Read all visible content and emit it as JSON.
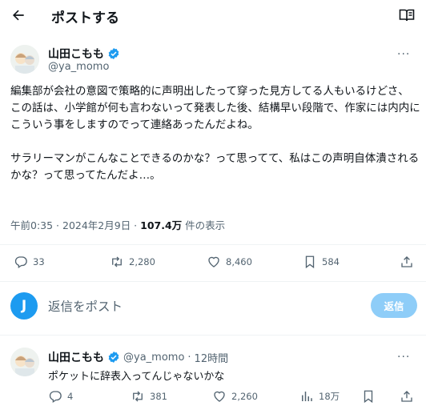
{
  "header": {
    "title": "ポストする"
  },
  "post": {
    "author_name": "山田こもも",
    "author_handle": "@ya_momo",
    "more_label": "···",
    "text": "編集部が会社の意図で策略的に声明出したって穿った見方してる人もいるけどさ、\nこの話は、小学館が何も言わないって発表した後、結構早い段階で、作家には内内にこういう事をしますのでって連絡あったんだよね。\n\nサラリーマンがこんなことできるのかな？って思ってて、私はこの声明自体潰されるかな？って思ってたんだよ…。",
    "timestamp": "午前0:35 · 2024年2月9日 · ",
    "views_count": "107.4万",
    "views_suffix": " 件の表示",
    "stats": {
      "replies": "33",
      "reposts": "2,280",
      "likes": "8,460",
      "bookmarks": "584"
    }
  },
  "composer": {
    "avatar_letter": "J",
    "placeholder": "返信をポスト",
    "button_label": "返信"
  },
  "reply": {
    "author_name": "山田こもも",
    "author_handle": "@ya_momo",
    "separator": "·",
    "time": "12時間",
    "more_label": "···",
    "text": "ポケットに辞表入ってんじゃないかな",
    "stats": {
      "replies": "4",
      "reposts": "381",
      "likes": "2,260",
      "views": "18万"
    }
  },
  "colors": {
    "accent": "#1d9bf0",
    "button_disabled": "#8ecdf8",
    "secondary_text": "#536471",
    "divider": "#eff3f4"
  }
}
